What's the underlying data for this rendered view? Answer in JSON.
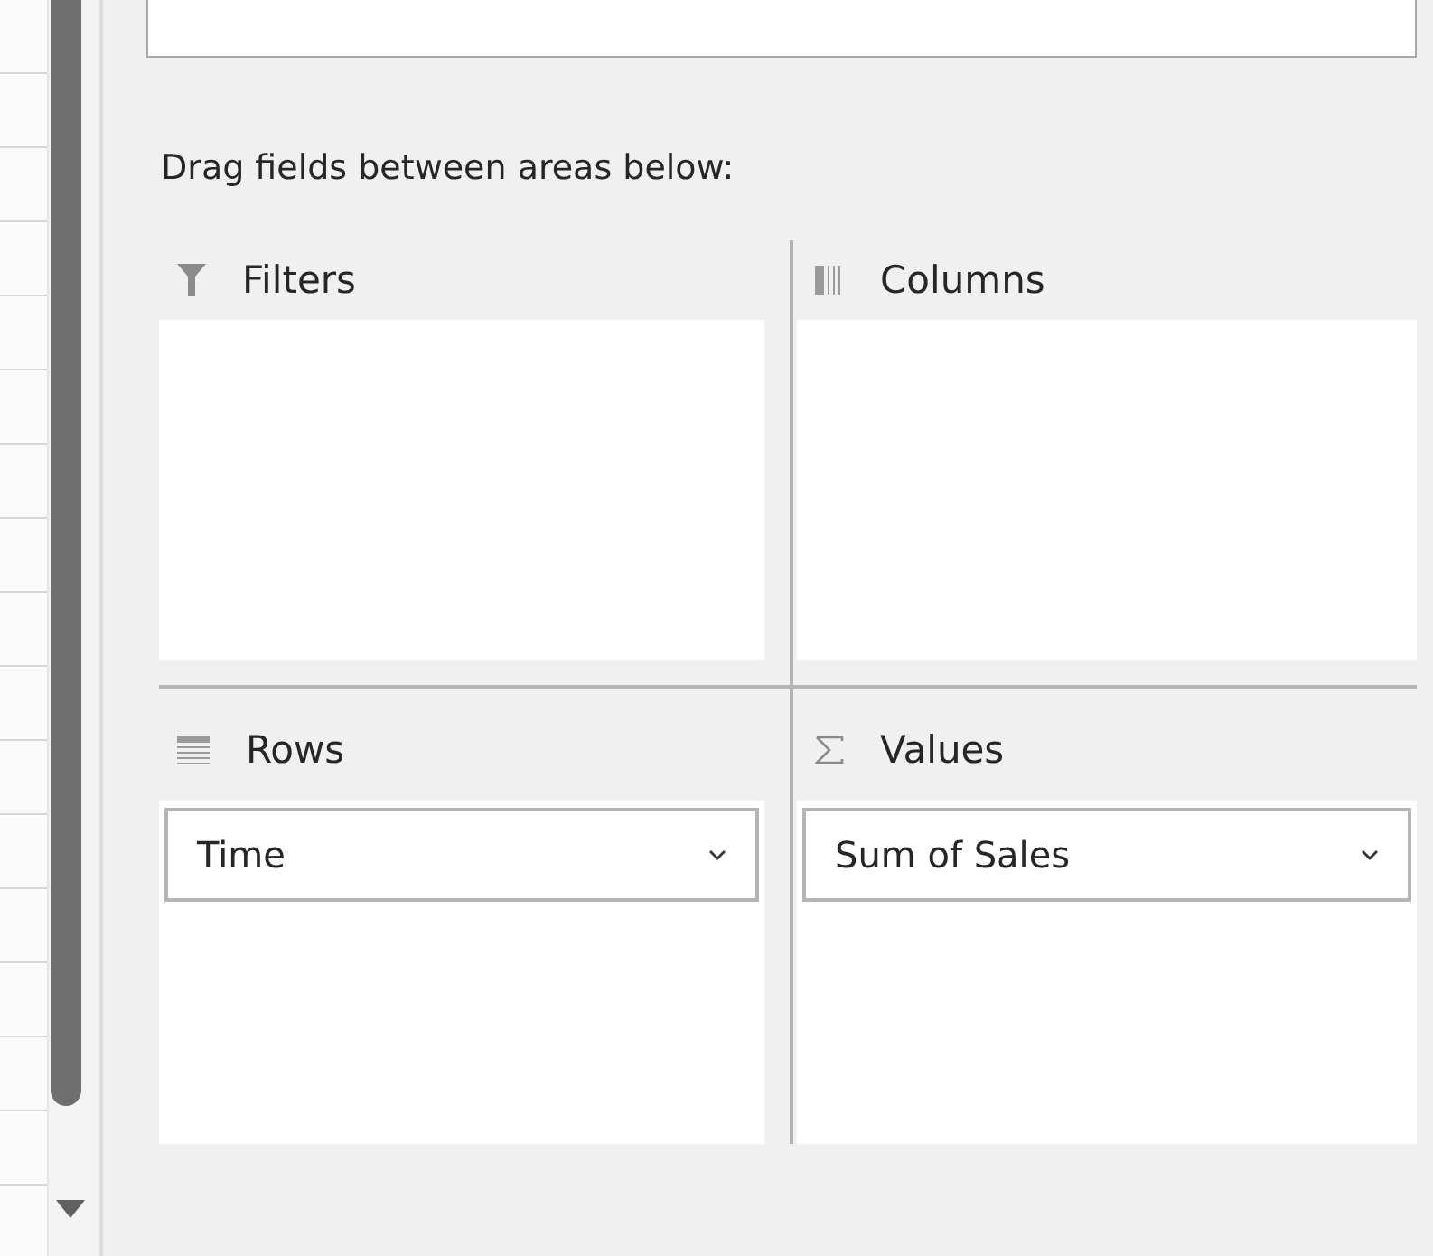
{
  "instruction": "Drag fields between areas below:",
  "areas": [
    {
      "kind": "filters",
      "label": "Filters"
    },
    {
      "kind": "columns",
      "label": "Columns"
    },
    {
      "kind": "rows",
      "label": "Rows",
      "fields": [
        {
          "label": "Time"
        }
      ]
    },
    {
      "kind": "values",
      "label": "Values",
      "fields": [
        {
          "label": "Sum of Sales"
        }
      ]
    }
  ]
}
